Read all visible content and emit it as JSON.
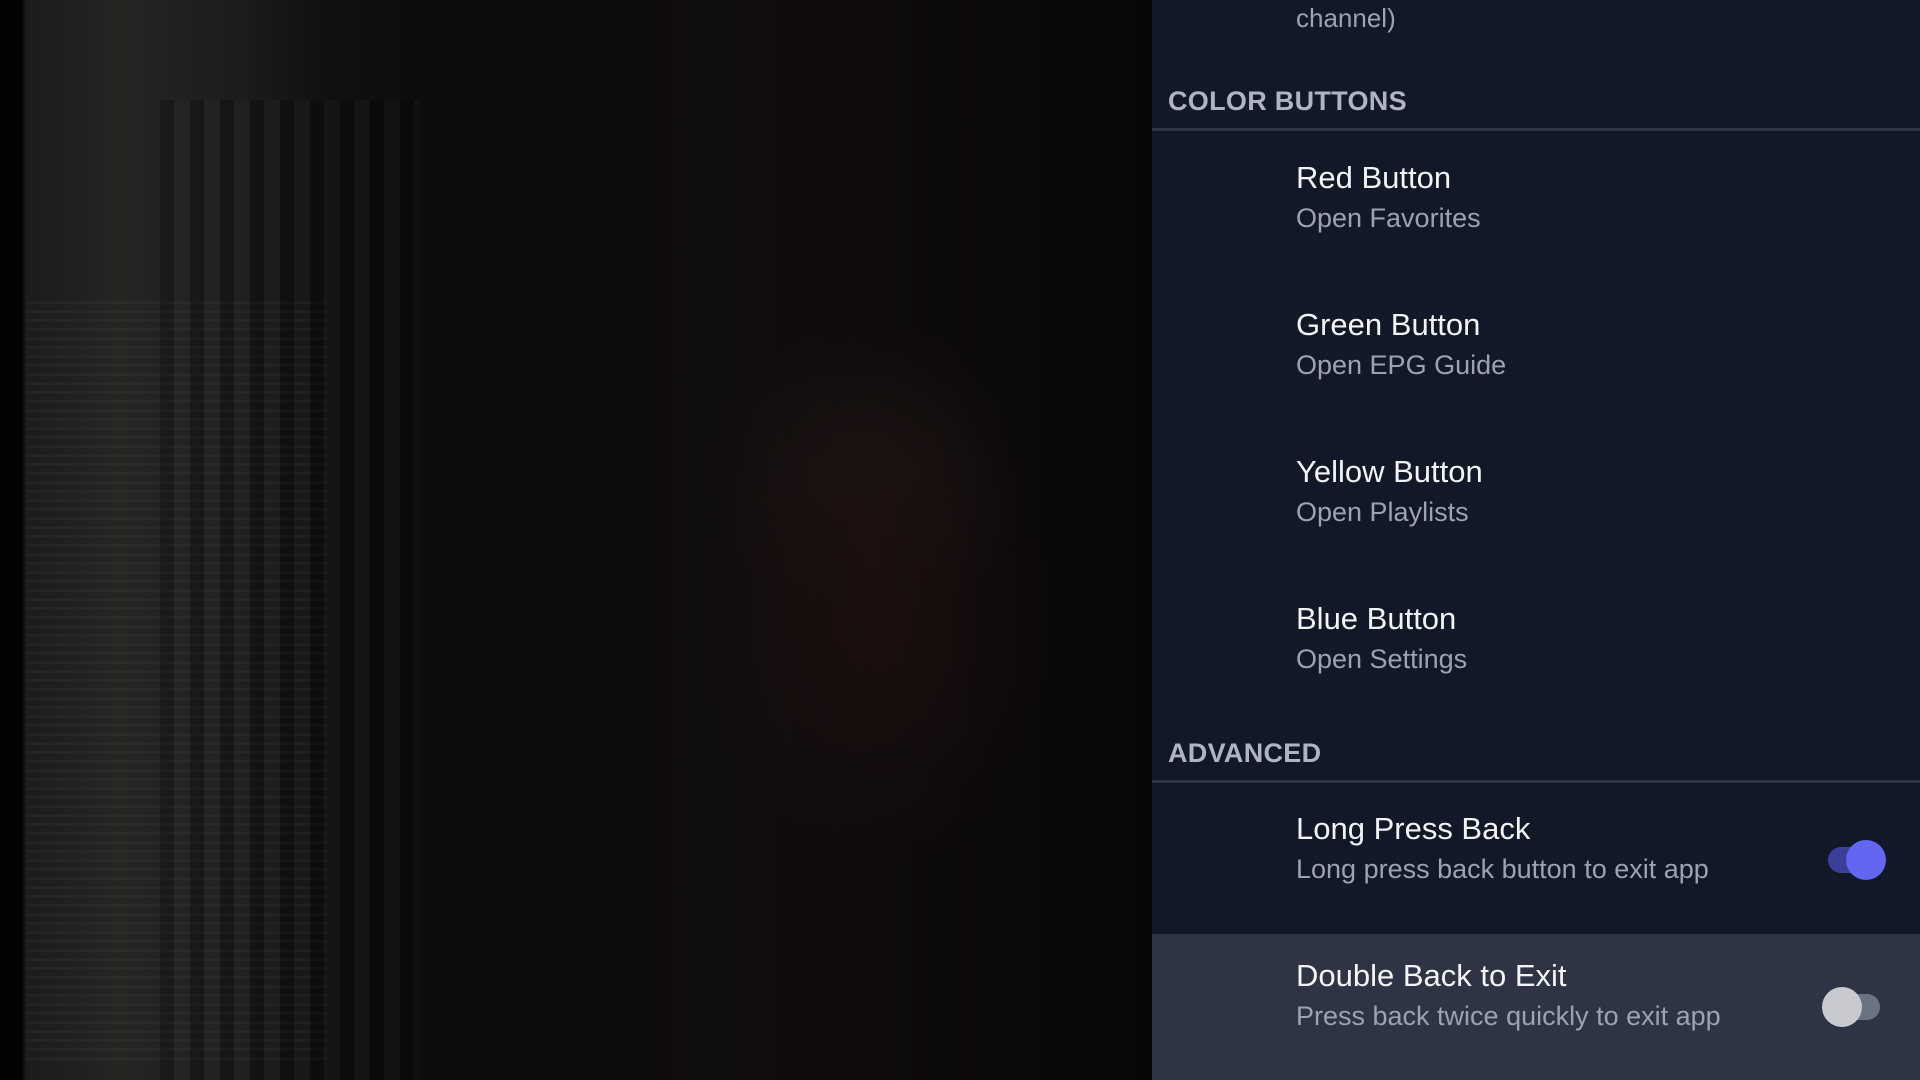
{
  "video": {
    "description_icon": "video-frame"
  },
  "settings": {
    "previous_item_subtitle_tail": "channel)",
    "sections": [
      {
        "title": "COLOR BUTTONS",
        "items": [
          {
            "title": "Red Button",
            "subtitle": "Open Favorites"
          },
          {
            "title": "Green Button",
            "subtitle": "Open EPG Guide"
          },
          {
            "title": "Yellow Button",
            "subtitle": "Open Playlists"
          },
          {
            "title": "Blue Button",
            "subtitle": "Open Settings"
          }
        ]
      },
      {
        "title": "ADVANCED",
        "items": [
          {
            "title": "Long Press Back",
            "subtitle": "Long press back button to exit app",
            "toggle": true
          },
          {
            "title": "Double Back to Exit",
            "subtitle": "Press back twice quickly to exit app",
            "toggle": false,
            "focused": true
          }
        ]
      }
    ],
    "colors": {
      "panel_bg": "#111827",
      "focused_row": "#2e3443",
      "accent": "#6366f1"
    }
  }
}
